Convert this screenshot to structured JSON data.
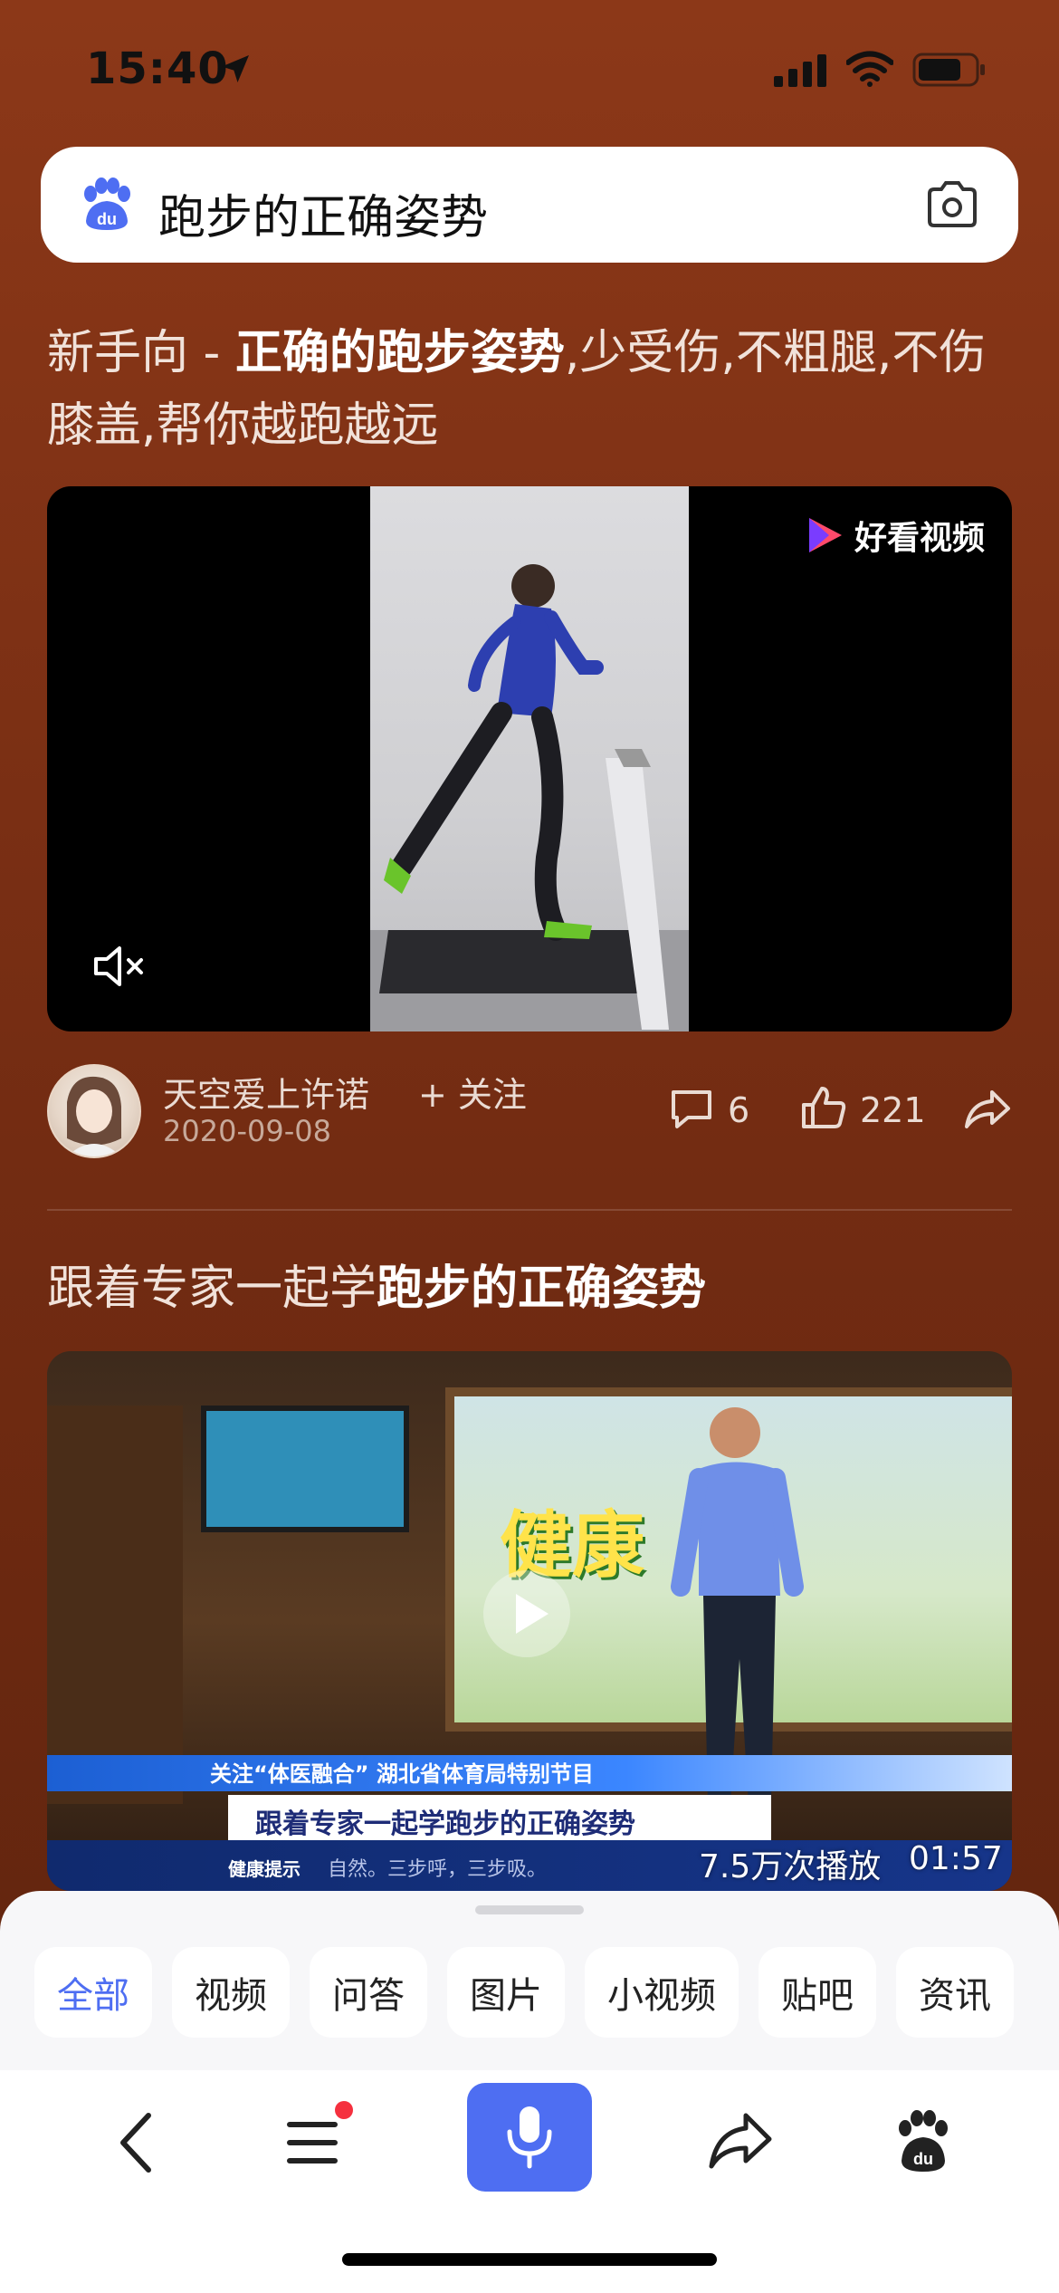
{
  "status_bar": {
    "time": "15:40"
  },
  "search": {
    "query": "跑步的正确姿势"
  },
  "results": [
    {
      "title_prefix": "新手向 - ",
      "title_bold": "正确的跑步姿势",
      "title_suffix": ",少受伤,不粗腿,不伤膝盖,帮你越跑越远",
      "source_badge": "好看视频",
      "author": "天空爱上许诺",
      "follow_label": "+ 关注",
      "date": "2020-09-08",
      "comments": "6",
      "likes": "221"
    },
    {
      "title_prefix": "跟着专家一起学",
      "title_bold": "跑步的正确姿势",
      "thumb_sign": "健康",
      "news_bar_text": "关注“体医融合” 湖北省体育局特别节目",
      "caption": "跟着专家一起学跑步的正确姿势",
      "tip_label": "健康提示",
      "tip_text": "自然。三步呼，三步吸。",
      "play_count": "7.5万次播放",
      "duration": "01:57"
    }
  ],
  "tabs": [
    {
      "label": "全部",
      "active": true
    },
    {
      "label": "视频"
    },
    {
      "label": "问答"
    },
    {
      "label": "图片"
    },
    {
      "label": "小视频"
    },
    {
      "label": "贴吧"
    },
    {
      "label": "资讯"
    }
  ],
  "colors": {
    "accent": "#4e6ef2",
    "background": "#7a2f14",
    "notification": "#f5303e"
  },
  "icons": [
    "location-arrow-icon",
    "signal-icon",
    "wifi-icon",
    "battery-icon",
    "baidu-paw-icon",
    "camera-icon",
    "haokan-logo-icon",
    "mute-icon",
    "comment-icon",
    "like-icon",
    "share-icon",
    "play-icon",
    "back-icon",
    "menu-icon",
    "mic-icon"
  ]
}
